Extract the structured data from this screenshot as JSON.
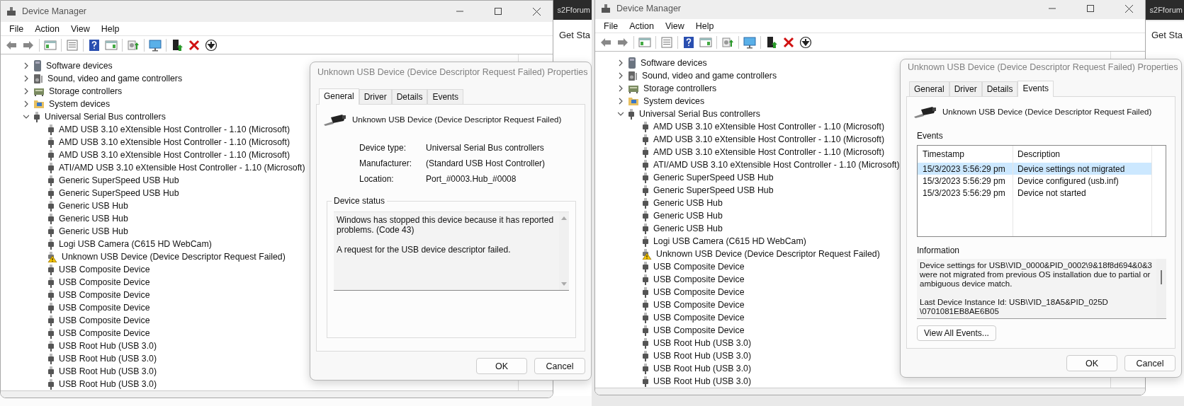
{
  "screens": [
    {
      "background": {
        "tab_text": "s2Fforum",
        "page_text": "Get Sta"
      },
      "window": {
        "title": "Device Manager",
        "menu": [
          "File",
          "Action",
          "View",
          "Help"
        ],
        "tree": [
          {
            "label": "Software devices",
            "kind": "software",
            "expanded": false
          },
          {
            "label": "Sound, video and game controllers",
            "kind": "sound",
            "expanded": false
          },
          {
            "label": "Storage controllers",
            "kind": "storage",
            "expanded": false
          },
          {
            "label": "System devices",
            "kind": "system",
            "expanded": false
          },
          {
            "label": "Universal Serial Bus controllers",
            "kind": "usb",
            "expanded": true,
            "children": [
              {
                "label": "AMD USB 3.10 eXtensible Host Controller - 1.10 (Microsoft)",
                "kind": "usb"
              },
              {
                "label": "AMD USB 3.10 eXtensible Host Controller - 1.10 (Microsoft)",
                "kind": "usb"
              },
              {
                "label": "AMD USB 3.10 eXtensible Host Controller - 1.10 (Microsoft)",
                "kind": "usb"
              },
              {
                "label": "ATI/AMD USB 3.10 eXtensible Host Controller - 1.10 (Microsoft)",
                "kind": "usb"
              },
              {
                "label": "Generic SuperSpeed USB Hub",
                "kind": "usb"
              },
              {
                "label": "Generic SuperSpeed USB Hub",
                "kind": "usb"
              },
              {
                "label": "Generic USB Hub",
                "kind": "usb"
              },
              {
                "label": "Generic USB Hub",
                "kind": "usb"
              },
              {
                "label": "Generic USB Hub",
                "kind": "usb"
              },
              {
                "label": "Logi USB Camera (C615 HD WebCam)",
                "kind": "usb"
              },
              {
                "label": "Unknown USB Device (Device Descriptor Request Failed)",
                "kind": "warning"
              },
              {
                "label": "USB Composite Device",
                "kind": "usb"
              },
              {
                "label": "USB Composite Device",
                "kind": "usb"
              },
              {
                "label": "USB Composite Device",
                "kind": "usb"
              },
              {
                "label": "USB Composite Device",
                "kind": "usb"
              },
              {
                "label": "USB Composite Device",
                "kind": "usb"
              },
              {
                "label": "USB Composite Device",
                "kind": "usb"
              },
              {
                "label": "USB Root Hub (USB 3.0)",
                "kind": "usb"
              },
              {
                "label": "USB Root Hub (USB 3.0)",
                "kind": "usb"
              },
              {
                "label": "USB Root Hub (USB 3.0)",
                "kind": "usb"
              },
              {
                "label": "USB Root Hub (USB 3.0)",
                "kind": "usb"
              }
            ]
          }
        ]
      },
      "dialog": {
        "title": "Unknown USB Device (Device Descriptor Request Failed) Properties",
        "tabs": [
          {
            "label": "General",
            "selected": true
          },
          {
            "label": "Driver",
            "selected": false
          },
          {
            "label": "Details",
            "selected": false
          },
          {
            "label": "Events",
            "selected": false
          }
        ],
        "device_name": "Unknown USB Device (Device Descriptor Request Failed)",
        "page": {
          "kind": "general",
          "properties": [
            {
              "label": "Device type:",
              "value": "Universal Serial Bus controllers"
            },
            {
              "label": "Manufacturer:",
              "value": "(Standard USB Host Controller)"
            },
            {
              "label": "Location:",
              "value": "Port_#0003.Hub_#0008"
            }
          ],
          "status_title": "Device status",
          "status_text": "Windows has stopped this device because it has reported problems. (Code 43)\n\nA request for the USB device descriptor failed."
        },
        "buttons": [
          "OK",
          "Cancel"
        ]
      }
    },
    {
      "background": {
        "tab_text": "s2Fforum",
        "page_text": "Get Sta"
      },
      "window": {
        "title": "Device Manager",
        "menu": [
          "File",
          "Action",
          "View",
          "Help"
        ],
        "tree": [
          {
            "label": "Software devices",
            "kind": "software",
            "expanded": false
          },
          {
            "label": "Sound, video and game controllers",
            "kind": "sound",
            "expanded": false
          },
          {
            "label": "Storage controllers",
            "kind": "storage",
            "expanded": false
          },
          {
            "label": "System devices",
            "kind": "system",
            "expanded": false
          },
          {
            "label": "Universal Serial Bus controllers",
            "kind": "usb",
            "expanded": true,
            "children": [
              {
                "label": "AMD USB 3.10 eXtensible Host Controller - 1.10 (Microsoft)",
                "kind": "usb"
              },
              {
                "label": "AMD USB 3.10 eXtensible Host Controller - 1.10 (Microsoft)",
                "kind": "usb"
              },
              {
                "label": "AMD USB 3.10 eXtensible Host Controller - 1.10 (Microsoft)",
                "kind": "usb"
              },
              {
                "label": "ATI/AMD USB 3.10 eXtensible Host Controller - 1.10 (Microsoft)",
                "kind": "usb"
              },
              {
                "label": "Generic SuperSpeed USB Hub",
                "kind": "usb"
              },
              {
                "label": "Generic SuperSpeed USB Hub",
                "kind": "usb"
              },
              {
                "label": "Generic USB Hub",
                "kind": "usb"
              },
              {
                "label": "Generic USB Hub",
                "kind": "usb"
              },
              {
                "label": "Generic USB Hub",
                "kind": "usb"
              },
              {
                "label": "Logi USB Camera (C615 HD WebCam)",
                "kind": "usb"
              },
              {
                "label": "Unknown USB Device (Device Descriptor Request Failed)",
                "kind": "warning"
              },
              {
                "label": "USB Composite Device",
                "kind": "usb"
              },
              {
                "label": "USB Composite Device",
                "kind": "usb"
              },
              {
                "label": "USB Composite Device",
                "kind": "usb"
              },
              {
                "label": "USB Composite Device",
                "kind": "usb"
              },
              {
                "label": "USB Composite Device",
                "kind": "usb"
              },
              {
                "label": "USB Composite Device",
                "kind": "usb"
              },
              {
                "label": "USB Root Hub (USB 3.0)",
                "kind": "usb"
              },
              {
                "label": "USB Root Hub (USB 3.0)",
                "kind": "usb"
              },
              {
                "label": "USB Root Hub (USB 3.0)",
                "kind": "usb"
              },
              {
                "label": "USB Root Hub (USB 3.0)",
                "kind": "usb"
              }
            ]
          }
        ]
      },
      "dialog": {
        "title": "Unknown USB Device (Device Descriptor Request Failed) Properties",
        "tabs": [
          {
            "label": "General",
            "selected": false
          },
          {
            "label": "Driver",
            "selected": false
          },
          {
            "label": "Details",
            "selected": false
          },
          {
            "label": "Events",
            "selected": true
          }
        ],
        "device_name": "Unknown USB Device (Device Descriptor Request Failed)",
        "page": {
          "kind": "events",
          "events_label": "Events",
          "columns": [
            "Timestamp",
            "Description"
          ],
          "rows": [
            {
              "cells": [
                "15/3/2023 5:56:29 pm",
                "Device settings not migrated"
              ],
              "selected": true
            },
            {
              "cells": [
                "15/3/2023 5:56:29 pm",
                "Device configured (usb.inf)"
              ],
              "selected": false
            },
            {
              "cells": [
                "15/3/2023 5:56:29 pm",
                "Device not started"
              ],
              "selected": false
            }
          ],
          "information_label": "Information",
          "information_text": "Device settings for USB\\VID_0000&PID_0002\\9&18f8d694&0&3 were not migrated from previous OS installation due to partial or ambiguous device match.\n\nLast Device Instance Id: USB\\VID_18A5&PID_025D\n\\0701081EB8AE6B05",
          "button": "View All Events..."
        },
        "buttons": [
          "OK",
          "Cancel"
        ]
      }
    }
  ]
}
